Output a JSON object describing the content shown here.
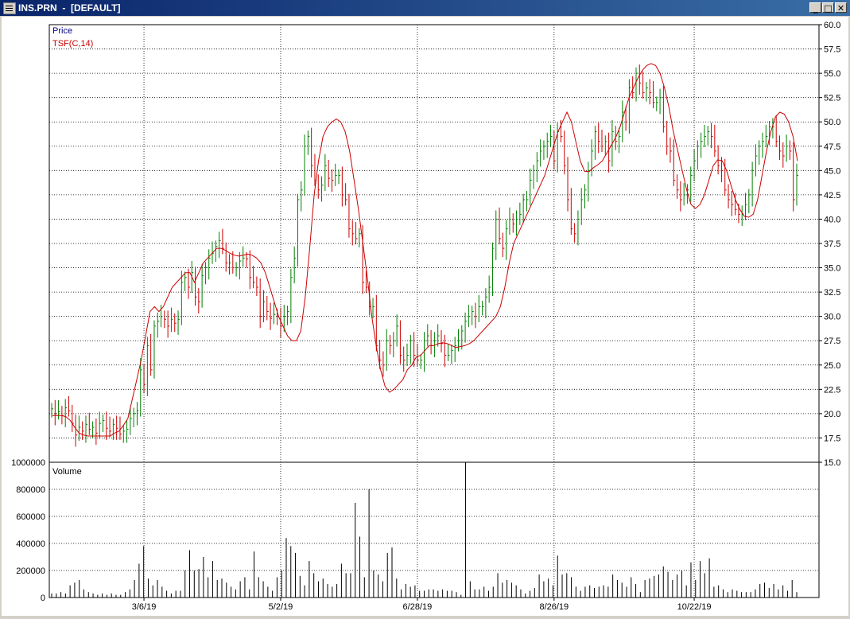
{
  "window": {
    "title": "INS.PRN  -  [DEFAULT]",
    "minimize_label": "_",
    "maximize_label": "□",
    "close_label": "✕"
  },
  "colors": {
    "up_bar": "#008000",
    "down_bar": "#cc0000",
    "tsf_line": "#cc0000",
    "price_label": "#000080",
    "grid": "#000000"
  },
  "chart_data": [
    {
      "type": "line",
      "panel": "price",
      "series_labels": [
        "Price",
        "TSF(C,14)"
      ],
      "ylim": [
        15.0,
        60.0
      ],
      "y_ticks": [
        "15.0",
        "17.5",
        "20.0",
        "22.5",
        "25.0",
        "27.5",
        "30.0",
        "32.5",
        "35.0",
        "37.5",
        "40.0",
        "42.5",
        "45.0",
        "47.5",
        "50.0",
        "52.5",
        "55.0",
        "57.5",
        "60.0"
      ],
      "x_tick_labels": [
        "3/6/19",
        "5/2/19",
        "6/28/19",
        "8/26/19",
        "10/22/19"
      ],
      "grid": true,
      "ohlc_closes": [
        20.5,
        20.0,
        20.2,
        19.8,
        20.6,
        20.3,
        19.0,
        17.8,
        18.6,
        18.2,
        18.9,
        18.4,
        18.6,
        18.0,
        19.0,
        19.3,
        18.5,
        18.2,
        18.9,
        18.5,
        17.9,
        18.2,
        18.4,
        19.5,
        20.0,
        20.3,
        24.5,
        23.0,
        27.0,
        24.5,
        29.0,
        29.5,
        30.0,
        29.7,
        29.0,
        29.7,
        29.3,
        29.7,
        33.5,
        34.0,
        33.0,
        34.5,
        32.0,
        31.5,
        34.2,
        35.0,
        36.0,
        36.5,
        37.2,
        37.8,
        37.0,
        35.5,
        35.5,
        35.0,
        35.0,
        35.7,
        36.0,
        35.9,
        34.0,
        33.5,
        33.0,
        30.0,
        31.5,
        30.5,
        29.8,
        30.2,
        30.0,
        29.0,
        30.0,
        30.5,
        34.0,
        36.0,
        42.0,
        43.0,
        47.5,
        48.5,
        45.5,
        44.0,
        43.0,
        43.5,
        45.5,
        44.2,
        44.0,
        44.5,
        44.5,
        42.5,
        42.0,
        39.0,
        38.5,
        38.0,
        38.5,
        33.5,
        33.0,
        31.0,
        31.0,
        27.0,
        25.5,
        25.0,
        27.5,
        27.0,
        27.5,
        29.0,
        26.0,
        25.5,
        26.0,
        27.5,
        26.0,
        25.5,
        25.5,
        27.5,
        28.0,
        27.0,
        27.5,
        28.0,
        27.2,
        26.0,
        26.0,
        26.5,
        27.0,
        27.5,
        28.5,
        29.5,
        30.0,
        30.5,
        30.0,
        31.0,
        31.0,
        32.0,
        33.0,
        37.0,
        40.0,
        38.0,
        37.0,
        39.0,
        40.0,
        39.5,
        40.0,
        40.5,
        42.0,
        42.0,
        44.0,
        45.0,
        46.0,
        47.0,
        47.5,
        48.0,
        48.5,
        46.0,
        49.0,
        48.5,
        45.5,
        42.0,
        39.0,
        38.5,
        40.0,
        42.0,
        43.0,
        45.0,
        47.0,
        49.0,
        48.0,
        47.5,
        48.0,
        46.0,
        49.0,
        48.0,
        48.5,
        51.0,
        50.0,
        53.5,
        53.0,
        55.0,
        54.0,
        53.0,
        53.5,
        53.0,
        52.0,
        52.0,
        52.5,
        49.5,
        47.5,
        47.0,
        44.0,
        43.0,
        42.0,
        42.5,
        43.0,
        44.5,
        46.0,
        47.5,
        48.0,
        48.5,
        49.0,
        48.5,
        47.0,
        45.5,
        45.0,
        43.0,
        42.0,
        41.5,
        41.0,
        40.5,
        40.5,
        41.5,
        42.5,
        45.0,
        46.5,
        47.5,
        48.0,
        48.5,
        49.5,
        49.5,
        48.0,
        47.0,
        46.5,
        47.5,
        47.0,
        42.0,
        44.5
      ],
      "tsf_values": [
        19.8,
        19.8,
        19.8,
        19.7,
        19.3,
        18.6,
        18.0,
        17.8,
        17.7,
        17.7,
        17.7,
        17.7,
        17.7,
        17.7,
        18.0,
        18.2,
        18.8,
        19.5,
        21.5,
        23.5,
        25.5,
        28.0,
        30.5,
        31.0,
        30.5,
        31.0,
        32.0,
        33.0,
        33.5,
        34.0,
        34.5,
        34.5,
        33.5,
        34.5,
        35.5,
        36.0,
        36.5,
        37.0,
        37.0,
        36.8,
        36.5,
        36.3,
        36.2,
        36.3,
        36.4,
        36.3,
        36.0,
        35.5,
        34.5,
        33.0,
        31.5,
        30.0,
        29.0,
        28.0,
        27.5,
        27.5,
        28.5,
        32.0,
        37.0,
        42.5,
        46.0,
        48.5,
        49.5,
        50.0,
        50.3,
        50.0,
        49.0,
        47.0,
        44.0,
        41.0,
        37.5,
        34.0,
        30.0,
        27.0,
        24.5,
        22.8,
        22.2,
        22.5,
        23.0,
        23.5,
        24.5,
        25.0,
        25.8,
        26.0,
        26.5,
        27.0,
        27.0,
        27.2,
        27.3,
        27.2,
        27.0,
        26.8,
        26.9,
        27.0,
        27.2,
        27.5,
        28.0,
        28.5,
        29.0,
        29.5,
        30.0,
        31.0,
        33.0,
        35.5,
        37.5,
        38.5,
        39.5,
        40.5,
        41.5,
        42.5,
        43.5,
        44.5,
        46.0,
        47.5,
        49.0,
        50.0,
        51.0,
        50.0,
        48.0,
        46.0,
        44.9,
        44.9,
        45.3,
        45.6,
        46.0,
        46.8,
        47.6,
        48.4,
        49.5,
        51.0,
        52.5,
        53.5,
        54.5,
        55.3,
        55.8,
        56.0,
        55.8,
        55.0,
        53.5,
        51.5,
        49.0,
        47.0,
        45.0,
        43.0,
        41.5,
        41.1,
        41.5,
        42.5,
        44.0,
        45.5,
        46.1,
        46.0,
        45.0,
        43.5,
        42.0,
        41.0,
        40.3,
        40.2,
        40.5,
        42.0,
        44.5,
        47.0,
        49.0,
        50.5,
        51.0,
        50.8,
        50.0,
        48.5,
        46.0
      ]
    },
    {
      "type": "bar",
      "panel": "volume",
      "series_labels": [
        "Volume"
      ],
      "ylim": [
        0,
        1000000
      ],
      "y_ticks": [
        "0",
        "200000",
        "400000",
        "600000",
        "800000",
        "1000000"
      ],
      "grid": true,
      "values": [
        30000,
        30000,
        40000,
        30000,
        90000,
        110000,
        130000,
        60000,
        40000,
        30000,
        20000,
        30000,
        20000,
        30000,
        20000,
        20000,
        40000,
        60000,
        130000,
        250000,
        380000,
        140000,
        90000,
        130000,
        80000,
        50000,
        30000,
        50000,
        50000,
        200000,
        350000,
        200000,
        210000,
        300000,
        150000,
        270000,
        130000,
        140000,
        110000,
        80000,
        60000,
        120000,
        150000,
        60000,
        340000,
        150000,
        120000,
        80000,
        50000,
        150000,
        200000,
        440000,
        380000,
        330000,
        160000,
        90000,
        270000,
        180000,
        120000,
        140000,
        100000,
        80000,
        100000,
        250000,
        180000,
        180000,
        700000,
        450000,
        150000,
        800000,
        200000,
        170000,
        120000,
        330000,
        370000,
        140000,
        60000,
        100000,
        80000,
        90000,
        50000,
        50000,
        60000,
        60000,
        50000,
        60000,
        50000,
        50000,
        40000,
        20000,
        1000000,
        120000,
        60000,
        60000,
        80000,
        50000,
        80000,
        180000,
        110000,
        130000,
        110000,
        90000,
        60000,
        30000,
        50000,
        70000,
        170000,
        120000,
        140000,
        90000,
        310000,
        170000,
        180000,
        150000,
        80000,
        50000,
        80000,
        90000,
        70000,
        80000,
        90000,
        80000,
        170000,
        130000,
        110000,
        80000,
        150000,
        100000,
        40000,
        130000,
        140000,
        160000,
        170000,
        230000,
        190000,
        130000,
        170000,
        200000,
        90000,
        260000,
        130000,
        270000,
        180000,
        290000,
        80000,
        90000,
        60000,
        40000,
        60000,
        50000,
        40000,
        40000,
        40000,
        60000,
        100000,
        110000,
        70000,
        100000,
        60000,
        90000,
        50000,
        130000,
        40000
      ]
    }
  ]
}
